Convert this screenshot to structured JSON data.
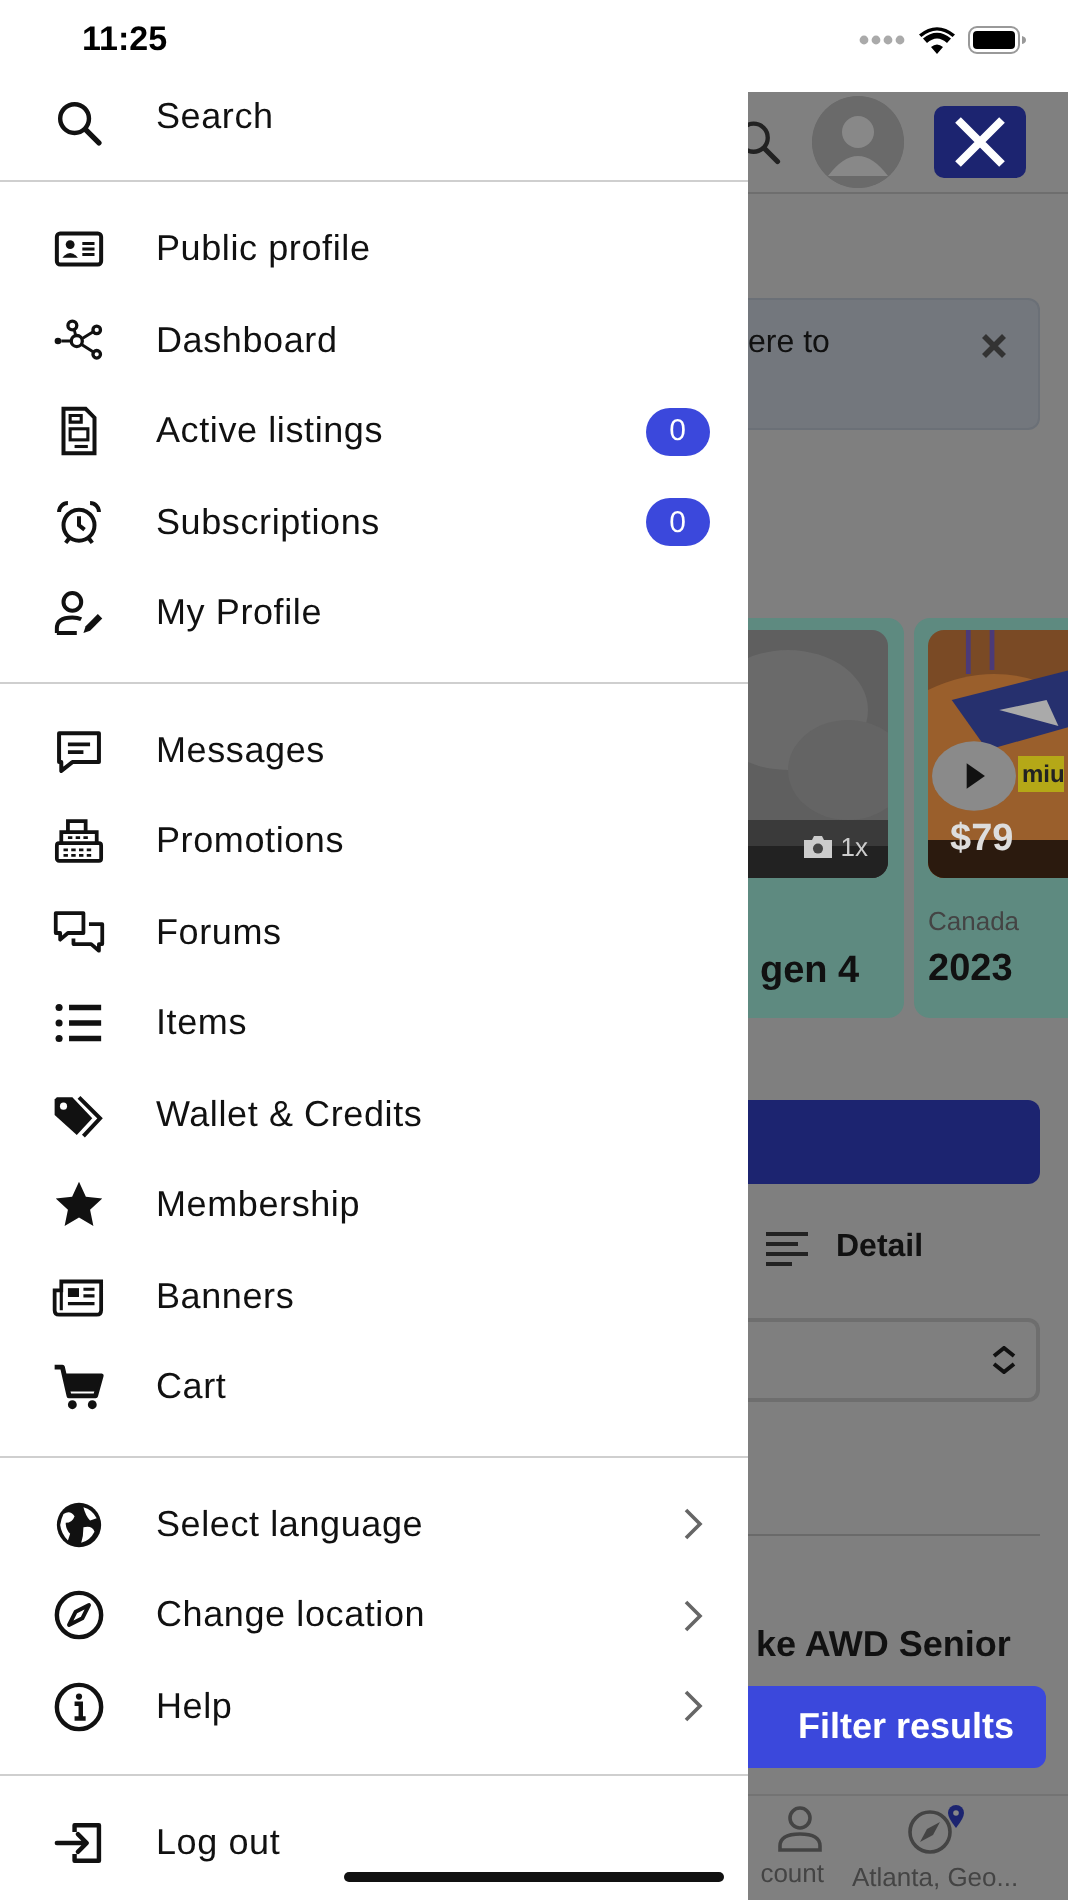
{
  "status_bar": {
    "time": "11:25"
  },
  "drawer": {
    "sections": [
      [
        {
          "label": "Search",
          "kind": "link"
        }
      ],
      [
        {
          "label": "Public profile",
          "kind": "link"
        },
        {
          "label": "Dashboard",
          "kind": "link"
        },
        {
          "label": "Active listings",
          "kind": "link",
          "badge": "0"
        },
        {
          "label": "Subscriptions",
          "kind": "link",
          "badge": "0"
        },
        {
          "label": "My Profile",
          "kind": "link"
        }
      ],
      [
        {
          "label": "Messages",
          "kind": "link"
        },
        {
          "label": "Promotions",
          "kind": "link"
        },
        {
          "label": "Forums",
          "kind": "link"
        },
        {
          "label": "Items",
          "kind": "link"
        },
        {
          "label": "Wallet & Credits",
          "kind": "link"
        },
        {
          "label": "Membership",
          "kind": "link"
        },
        {
          "label": "Banners",
          "kind": "link"
        },
        {
          "label": "Cart",
          "kind": "link"
        }
      ],
      [
        {
          "label": "Select language",
          "kind": "submenu"
        },
        {
          "label": "Change location",
          "kind": "submenu"
        },
        {
          "label": "Help",
          "kind": "submenu"
        }
      ],
      [
        {
          "label": "Log out",
          "kind": "link"
        }
      ]
    ]
  },
  "background": {
    "banner_text": "ere to",
    "cards": [
      {
        "photo_count": "1x",
        "title": "gen 4"
      },
      {
        "tag": "miu",
        "price": "$79",
        "location": "Canada",
        "title": "2023"
      }
    ],
    "view_toggle": "Detail",
    "listing_title": "ke AWD Senior",
    "filter_button": "Filter results",
    "nav": [
      {
        "label": "count"
      },
      {
        "label": "Atlanta, Geo..."
      }
    ]
  }
}
